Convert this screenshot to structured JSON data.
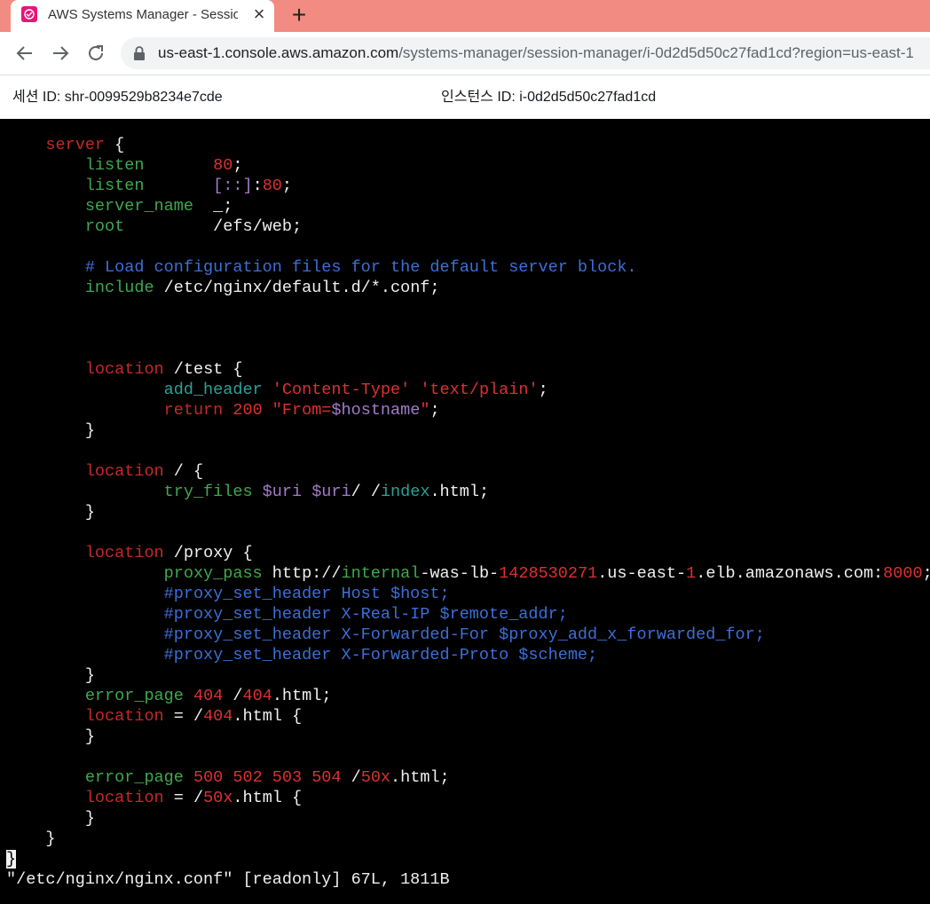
{
  "browser": {
    "tab_title": "AWS Systems Manager - Session Manager",
    "url_host": "us-east-1.console.aws.amazon.com",
    "url_path": "/systems-manager/session-manager/i-0d2d5d50c27fad1cd?region=us-east-1"
  },
  "session": {
    "session_id": "세션 ID: shr-0099529b8234e7cde",
    "instance_id": "인스턴스 ID: i-0d2d5d50c27fad1cd"
  },
  "terminal": {
    "lines": [
      {
        "parts": [
          [
            "    ",
            "w"
          ],
          [
            "server",
            "dred"
          ],
          [
            " {",
            "w"
          ]
        ]
      },
      {
        "parts": [
          [
            "        ",
            "w"
          ],
          [
            "listen",
            "grn"
          ],
          [
            "       ",
            "w"
          ],
          [
            "80",
            "red"
          ],
          [
            ";",
            "w"
          ]
        ]
      },
      {
        "parts": [
          [
            "        ",
            "w"
          ],
          [
            "listen",
            "grn"
          ],
          [
            "       ",
            "w"
          ],
          [
            "[::]",
            "pur"
          ],
          [
            ":",
            "w"
          ],
          [
            "80",
            "red"
          ],
          [
            ";",
            "w"
          ]
        ]
      },
      {
        "parts": [
          [
            "        ",
            "w"
          ],
          [
            "server_name",
            "grn"
          ],
          [
            "  _;",
            "w"
          ]
        ]
      },
      {
        "parts": [
          [
            "        ",
            "w"
          ],
          [
            "root",
            "grn"
          ],
          [
            "         /efs/web;",
            "w"
          ]
        ]
      },
      {
        "parts": [
          [
            "",
            "w"
          ]
        ]
      },
      {
        "parts": [
          [
            "        ",
            "w"
          ],
          [
            "# Load configuration files for the default server block.",
            "blue"
          ]
        ]
      },
      {
        "parts": [
          [
            "        ",
            "w"
          ],
          [
            "include",
            "grn"
          ],
          [
            " /etc/nginx/default.d/*.conf;",
            "w"
          ]
        ]
      },
      {
        "parts": [
          [
            "",
            "w"
          ]
        ]
      },
      {
        "parts": [
          [
            "",
            "w"
          ]
        ]
      },
      {
        "parts": [
          [
            "",
            "w"
          ]
        ]
      },
      {
        "parts": [
          [
            "        ",
            "w"
          ],
          [
            "location",
            "dred"
          ],
          [
            " /test {",
            "w"
          ]
        ]
      },
      {
        "parts": [
          [
            "                ",
            "w"
          ],
          [
            "add_header",
            "teal"
          ],
          [
            " ",
            "w"
          ],
          [
            "'Content-Type'",
            "red"
          ],
          [
            " ",
            "w"
          ],
          [
            "'text/plain'",
            "red"
          ],
          [
            ";",
            "w"
          ]
        ]
      },
      {
        "parts": [
          [
            "                ",
            "w"
          ],
          [
            "return",
            "dred"
          ],
          [
            " ",
            "w"
          ],
          [
            "200",
            "red"
          ],
          [
            " ",
            "w"
          ],
          [
            "\"From=",
            "red"
          ],
          [
            "$hostname",
            "pur"
          ],
          [
            "\"",
            "red"
          ],
          [
            ";",
            "w"
          ]
        ]
      },
      {
        "parts": [
          [
            "        }",
            "w"
          ]
        ]
      },
      {
        "parts": [
          [
            "",
            "w"
          ]
        ]
      },
      {
        "parts": [
          [
            "        ",
            "w"
          ],
          [
            "location",
            "dred"
          ],
          [
            " / {",
            "w"
          ]
        ]
      },
      {
        "parts": [
          [
            "                ",
            "w"
          ],
          [
            "try_files",
            "grn"
          ],
          [
            " ",
            "w"
          ],
          [
            "$uri",
            "pur"
          ],
          [
            " ",
            "w"
          ],
          [
            "$uri",
            "pur"
          ],
          [
            "/ /",
            "w"
          ],
          [
            "index",
            "teal"
          ],
          [
            ".html;",
            "w"
          ]
        ]
      },
      {
        "parts": [
          [
            "        }",
            "w"
          ]
        ]
      },
      {
        "parts": [
          [
            "",
            "w"
          ]
        ]
      },
      {
        "parts": [
          [
            "        ",
            "w"
          ],
          [
            "location",
            "dred"
          ],
          [
            " /proxy {",
            "w"
          ]
        ]
      },
      {
        "parts": [
          [
            "                ",
            "w"
          ],
          [
            "proxy_pass",
            "grn"
          ],
          [
            " http://",
            "w"
          ],
          [
            "internal",
            "grn"
          ],
          [
            "-was-lb-",
            "w"
          ],
          [
            "1428530271",
            "red"
          ],
          [
            ".us-east-",
            "w"
          ],
          [
            "1",
            "red"
          ],
          [
            ".elb.amazonaws.com:",
            "w"
          ],
          [
            "8000",
            "red"
          ],
          [
            ";",
            "w"
          ]
        ]
      },
      {
        "parts": [
          [
            "                ",
            "w"
          ],
          [
            "#proxy_set_header Host $host;",
            "blue"
          ]
        ]
      },
      {
        "parts": [
          [
            "                ",
            "w"
          ],
          [
            "#proxy_set_header X-Real-IP $remote_addr;",
            "blue"
          ]
        ]
      },
      {
        "parts": [
          [
            "                ",
            "w"
          ],
          [
            "#proxy_set_header X-Forwarded-For $proxy_add_x_forwarded_for;",
            "blue"
          ]
        ]
      },
      {
        "parts": [
          [
            "                ",
            "w"
          ],
          [
            "#proxy_set_header X-Forwarded-Proto $scheme;",
            "blue"
          ]
        ]
      },
      {
        "parts": [
          [
            "        }",
            "w"
          ]
        ]
      },
      {
        "parts": [
          [
            "        ",
            "w"
          ],
          [
            "error_page",
            "grn"
          ],
          [
            " ",
            "w"
          ],
          [
            "404",
            "red"
          ],
          [
            " /",
            "w"
          ],
          [
            "404",
            "red"
          ],
          [
            ".html;",
            "w"
          ]
        ]
      },
      {
        "parts": [
          [
            "        ",
            "w"
          ],
          [
            "location",
            "dred"
          ],
          [
            " = /",
            "w"
          ],
          [
            "404",
            "red"
          ],
          [
            ".html {",
            "w"
          ]
        ]
      },
      {
        "parts": [
          [
            "        }",
            "w"
          ]
        ]
      },
      {
        "parts": [
          [
            "",
            "w"
          ]
        ]
      },
      {
        "parts": [
          [
            "        ",
            "w"
          ],
          [
            "error_page",
            "grn"
          ],
          [
            " ",
            "w"
          ],
          [
            "500 502 503 504",
            "red"
          ],
          [
            " /",
            "w"
          ],
          [
            "50x",
            "red"
          ],
          [
            ".html;",
            "w"
          ]
        ]
      },
      {
        "parts": [
          [
            "        ",
            "w"
          ],
          [
            "location",
            "dred"
          ],
          [
            " = /",
            "w"
          ],
          [
            "50x",
            "red"
          ],
          [
            ".html {",
            "w"
          ]
        ]
      },
      {
        "parts": [
          [
            "        }",
            "w"
          ]
        ]
      },
      {
        "parts": [
          [
            "    }",
            "w"
          ]
        ]
      },
      {
        "parts": [
          [
            "}",
            "cursor"
          ]
        ]
      },
      {
        "parts": [
          [
            "\"/etc/nginx/nginx.conf\" [readonly] 67L, 1811B",
            "w"
          ]
        ]
      }
    ]
  }
}
